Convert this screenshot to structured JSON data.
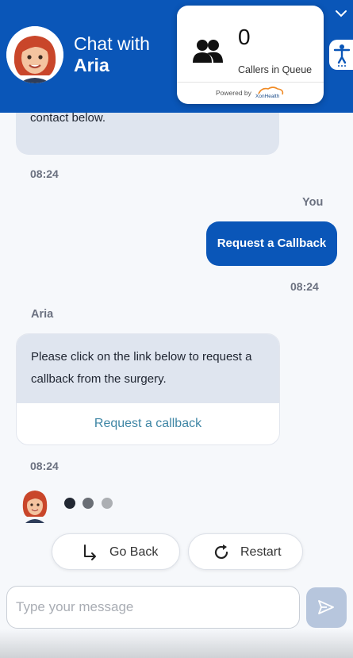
{
  "header": {
    "title_line1": "Chat with",
    "title_line2": "Aria",
    "bg_color": "#0a56b8",
    "icons": [
      "aria-avatar",
      "chevron-down-icon",
      "accessibility-icon"
    ]
  },
  "queue": {
    "count": "0",
    "label": "Callers in Queue",
    "powered_by": "Powered by",
    "icon": "users-icon"
  },
  "messages": {
    "m1_text": "contact below.",
    "m1_time": "08:24",
    "m2_sender": "You",
    "m2_text": "Request a Callback",
    "m2_time": "08:24",
    "m3_sender": "Aria",
    "m3_text": "Please click on the link below to request a callback from the surgery.",
    "m3_link": "Request a callback",
    "m3_time": "08:24"
  },
  "typing": {
    "dots": [
      "#222833",
      "#6a6e75",
      "#acafb3"
    ]
  },
  "actions": {
    "go_back": "Go Back",
    "restart": "Restart"
  },
  "composer": {
    "placeholder": "Type your message",
    "value": ""
  }
}
